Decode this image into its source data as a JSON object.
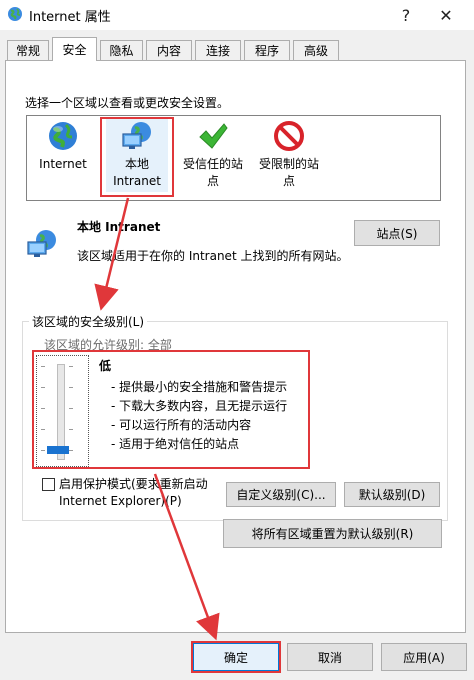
{
  "window": {
    "title": "Internet 属性",
    "help": "?",
    "close": "✕"
  },
  "tabs": [
    {
      "label": "常规"
    },
    {
      "label": "安全"
    },
    {
      "label": "隐私"
    },
    {
      "label": "内容"
    },
    {
      "label": "连接"
    },
    {
      "label": "程序"
    },
    {
      "label": "高级"
    }
  ],
  "security": {
    "instruction": "选择一个区域以查看或更改安全设置。",
    "zones": [
      {
        "line1": "Internet",
        "line2": ""
      },
      {
        "line1": "本地",
        "line2": "Intranet"
      },
      {
        "line1": "受信任的站",
        "line2": "点"
      },
      {
        "line1": "受限制的站",
        "line2": "点"
      }
    ],
    "selected_zone": {
      "name": "本地 Intranet",
      "description": "该区域适用于在你的 Intranet 上找到的所有网站。",
      "sites_button": "站点(S)"
    },
    "level_group_title": "该区域的安全级别(L)",
    "allowed_levels": "该区域的允许级别: 全部",
    "level": {
      "name": "低",
      "slider_fraction": 0.0,
      "bullets": [
        "- 提供最小的安全措施和警告提示",
        "- 下载大多数内容，且无提示运行",
        "- 可以运行所有的活动内容",
        "- 适用于绝对信任的站点"
      ]
    },
    "protected_mode": {
      "line1": "启用保护模式(要求重新启动",
      "line2": "Internet Explorer)(P)",
      "checked": false
    },
    "custom_level_button": "自定义级别(C)...",
    "default_level_button": "默认级别(D)",
    "reset_all_button": "将所有区域重置为默认级别(R)"
  },
  "dialog_buttons": {
    "ok": "确定",
    "cancel": "取消",
    "apply": "应用(A)"
  },
  "colors": {
    "annotation_red": "#e0373a",
    "slider_thumb": "#1a73d0"
  }
}
